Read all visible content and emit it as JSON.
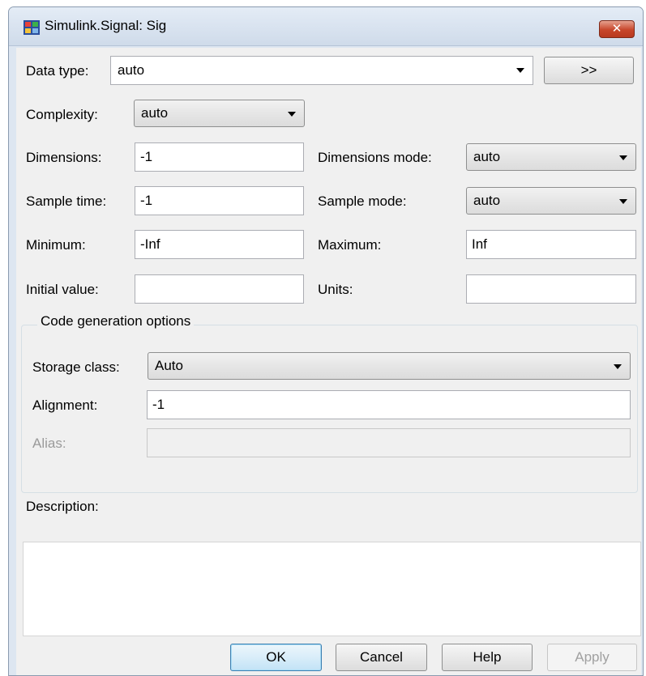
{
  "window": {
    "title": "Simulink.Signal: Sig",
    "close_label": "✕"
  },
  "data_type": {
    "label": "Data type:",
    "value": "auto",
    "expand_label": ">>"
  },
  "complexity": {
    "label": "Complexity:",
    "value": "auto"
  },
  "dimensions": {
    "label": "Dimensions:",
    "value": "-1"
  },
  "dimensions_mode": {
    "label": "Dimensions mode:",
    "value": "auto"
  },
  "sample_time": {
    "label": "Sample time:",
    "value": "-1"
  },
  "sample_mode": {
    "label": "Sample mode:",
    "value": "auto"
  },
  "minimum": {
    "label": "Minimum:",
    "value": "-Inf"
  },
  "maximum": {
    "label": "Maximum:",
    "value": "Inf"
  },
  "initial_value": {
    "label": "Initial value:",
    "value": ""
  },
  "units": {
    "label": "Units:",
    "value": ""
  },
  "code_gen": {
    "title": "Code generation options",
    "storage_class": {
      "label": "Storage class:",
      "value": "Auto"
    },
    "alignment": {
      "label": "Alignment:",
      "value": "-1"
    },
    "alias": {
      "label": "Alias:",
      "value": ""
    }
  },
  "description": {
    "label": "Description:",
    "value": ""
  },
  "buttons": {
    "ok": "OK",
    "cancel": "Cancel",
    "help": "Help",
    "apply": "Apply"
  }
}
